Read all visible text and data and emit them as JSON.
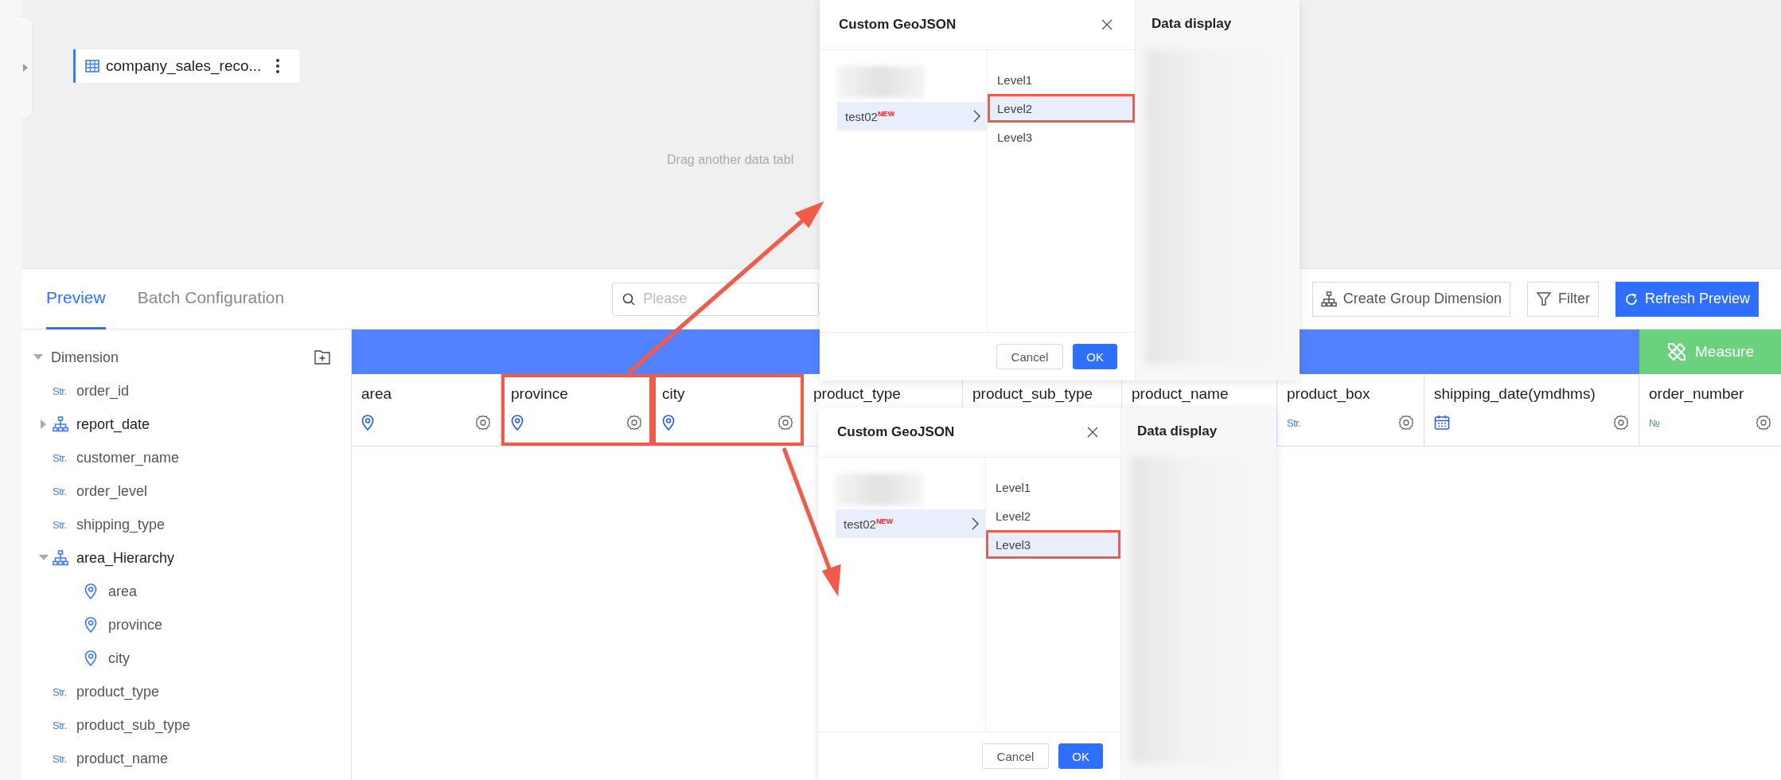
{
  "canvas": {
    "table_chip": {
      "label": "company_sales_reco..."
    },
    "hint": "Drag another data tabl"
  },
  "tabs": [
    {
      "label": "Preview",
      "selected": true
    },
    {
      "label": "Batch Configuration",
      "selected": false
    }
  ],
  "search": {
    "placeholder": "Please"
  },
  "toolbar": [
    {
      "label": "Create Group Dimension",
      "kind": "group"
    },
    {
      "label": "Filter",
      "kind": "filter"
    },
    {
      "label": "Refresh Preview",
      "kind": "refresh"
    }
  ],
  "field_tree": {
    "title": "Dimension",
    "expanded": true,
    "items": [
      {
        "name": "order_id",
        "kind": "text",
        "badge": "Str."
      },
      {
        "name": "report_date",
        "kind": "hierarchy",
        "expanded": false
      },
      {
        "name": "customer_name",
        "kind": "text",
        "badge": "Str."
      },
      {
        "name": "order_level",
        "kind": "text",
        "badge": "Str."
      },
      {
        "name": "shipping_type",
        "kind": "text",
        "badge": "Str."
      },
      {
        "name": "area_Hierarchy",
        "kind": "hierarchy",
        "expanded": true,
        "children": [
          {
            "name": "area",
            "kind": "geo"
          },
          {
            "name": "province",
            "kind": "geo"
          },
          {
            "name": "city",
            "kind": "geo"
          }
        ]
      },
      {
        "name": "product_type",
        "kind": "text",
        "badge": "Str."
      },
      {
        "name": "product_sub_type",
        "kind": "text",
        "badge": "Str."
      },
      {
        "name": "product_name",
        "kind": "text",
        "badge": "Str."
      }
    ]
  },
  "table": {
    "measure_band": {
      "label": "Measure"
    },
    "columns": [
      {
        "name": "area",
        "kind": "geo",
        "annotated": false
      },
      {
        "name": "province",
        "kind": "geo",
        "annotated": true
      },
      {
        "name": "city",
        "kind": "geo",
        "annotated": true
      },
      {
        "name": "product_type",
        "annotated": false
      },
      {
        "name": "product_sub_type",
        "annotated": false
      },
      {
        "name": "product_name",
        "annotated": false
      },
      {
        "name": "product_box",
        "kind": "text",
        "badge": "Str.",
        "annotated": false
      },
      {
        "name": "shipping_date(ymdhms)",
        "kind": "date",
        "annotated": false
      },
      {
        "name": "order_number",
        "kind": "number",
        "badge": "№",
        "annotated": false
      }
    ]
  },
  "dialogs": [
    {
      "title": "Custom GeoJSON",
      "sources": [
        {
          "kind": "blurred"
        },
        {
          "kind": "item",
          "label": "test02$^{NEW}$",
          "selected": true
        }
      ],
      "levels": [
        {
          "label": "Level1",
          "selected": false,
          "annotated": false
        },
        {
          "label": "Level2",
          "selected": true,
          "annotated": true
        },
        {
          "label": "Level3",
          "selected": false,
          "annotated": false
        }
      ],
      "cancel": "Cancel",
      "ok": "OK",
      "side_panel": {
        "title": "Data display"
      }
    },
    {
      "title": "Custom GeoJSON",
      "sources": [
        {
          "kind": "blurred"
        },
        {
          "kind": "item",
          "label": "test02$^{NEW}$",
          "selected": true
        }
      ],
      "levels": [
        {
          "label": "Level1",
          "selected": false,
          "annotated": false
        },
        {
          "label": "Level2",
          "selected": false,
          "annotated": false
        },
        {
          "label": "Level3",
          "selected": true,
          "annotated": true
        }
      ],
      "cancel": "Cancel",
      "ok": "OK",
      "side_panel": {
        "title": "Data display"
      }
    }
  ]
}
